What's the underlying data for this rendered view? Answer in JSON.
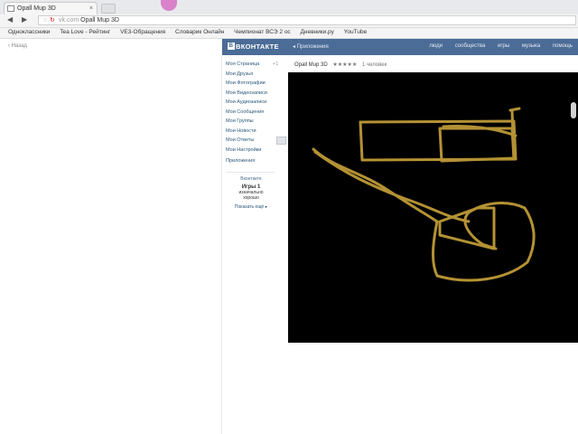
{
  "browser": {
    "tab_title": "Opall Mup 3D",
    "tab_close": "×",
    "address": {
      "host": "vk.com",
      "path": "Opall Mup 3D"
    },
    "bookmarks": [
      "Одноклассники",
      "Tea Love - Рейтинг",
      "VE3-Обращения",
      "Словарик Онлайн",
      "Чемпионат ВСЭ 2 ос",
      "Дневники.ру",
      "YouTube"
    ]
  },
  "left_pane": {
    "back_label": "Назад"
  },
  "vk": {
    "logo": "ВКОНТАКТЕ",
    "apps_link": "◂ Приложения",
    "nav": [
      "люди",
      "сообщества",
      "игры",
      "музыка",
      "помощь"
    ],
    "side_menu": [
      "Моя Страница",
      "Мои Друзья",
      "Мои Фотографии",
      "Мои Видеозаписи",
      "Мои Аудиозаписи",
      "Мои Сообщения",
      "Мои Группы",
      "Мои Новости",
      "Мои Ответы",
      "Мои Настройки"
    ],
    "friends_count": "+1",
    "apps_item": "Приложения",
    "ad": {
      "title": "Вконтакте",
      "line1": "Игры 1",
      "line2": "изначально",
      "line3": "хорошо",
      "more": "Показать ещё ▸"
    },
    "app_title": "Opall Mup 3D",
    "stars": "★★★★★",
    "friends_online": "1 человек"
  },
  "colors": {
    "vk_header": "#4b6c97",
    "game_bg": "#000000",
    "stroke": "#c8a23a"
  }
}
